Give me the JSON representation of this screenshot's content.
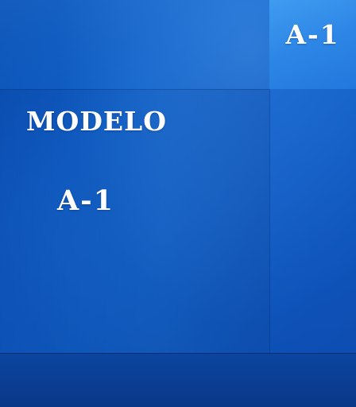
{
  "corner_label": "A-1",
  "title": "MODELO",
  "subtitle": "A-1",
  "colors": {
    "background": "#0b5ec6",
    "corner_box": "#3f9cf0",
    "bottom_band": "#0a3d92",
    "text": "#ffffff"
  }
}
